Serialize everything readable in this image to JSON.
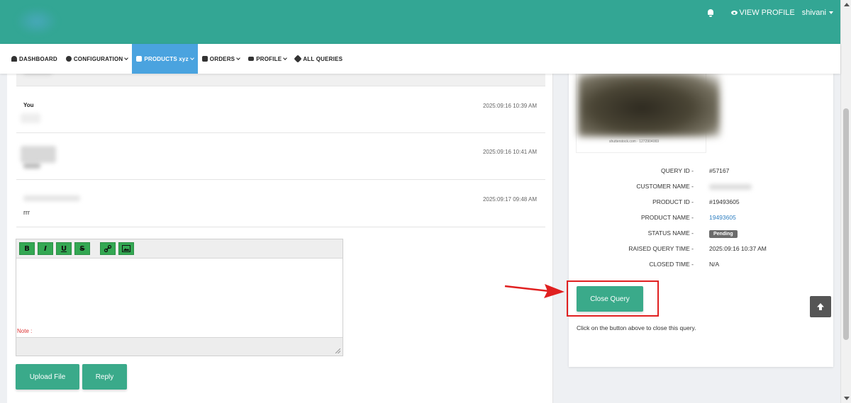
{
  "header": {
    "view_profile_label": "VIEW PROFILE",
    "username": "shivani",
    "accent_color": "#33a694"
  },
  "nav": {
    "items": [
      {
        "label": "DASHBOARD",
        "icon": "dashboard-icon"
      },
      {
        "label": "CONFIGURATION",
        "icon": "gear-icon"
      },
      {
        "label": "PRODUCTS xyz",
        "icon": "products-icon"
      },
      {
        "label": "ORDERS",
        "icon": "clipboard-icon"
      },
      {
        "label": "PROFILE",
        "icon": "id-card-icon"
      },
      {
        "label": "ALL QUERIES",
        "icon": "queries-icon"
      }
    ]
  },
  "messages": [
    {
      "author": "You",
      "time": "2025:09:16 10:39 AM",
      "text": ""
    },
    {
      "author": "",
      "time": "2025:09:16 10:41 AM",
      "text": ""
    },
    {
      "author": "",
      "time": "2025:09:17 09:48 AM",
      "text": "rrr"
    }
  ],
  "editor": {
    "toolbar": [
      "B",
      "I",
      "U",
      "S"
    ]
  },
  "actions": {
    "upload_label": "Upload File",
    "reply_label": "Reply",
    "note_label": "Note :"
  },
  "query_info": {
    "image_caption": "shutterstock.com · 1272904069",
    "rows": [
      {
        "label": "QUERY ID -",
        "value": "#57167"
      },
      {
        "label": "CUSTOMER NAME -",
        "value": ""
      },
      {
        "label": "PRODUCT ID -",
        "value": "#19493605"
      },
      {
        "label": "PRODUCT NAME -",
        "value": "19493605"
      },
      {
        "label": "STATUS NAME -",
        "value": "Pending"
      },
      {
        "label": "RAISED QUERY TIME -",
        "value": "2025:09:16 10:37 AM"
      },
      {
        "label": "CLOSED TIME -",
        "value": "N/A"
      }
    ],
    "close_button_label": "Close Query",
    "close_note": "Click on the button above to close this query."
  }
}
